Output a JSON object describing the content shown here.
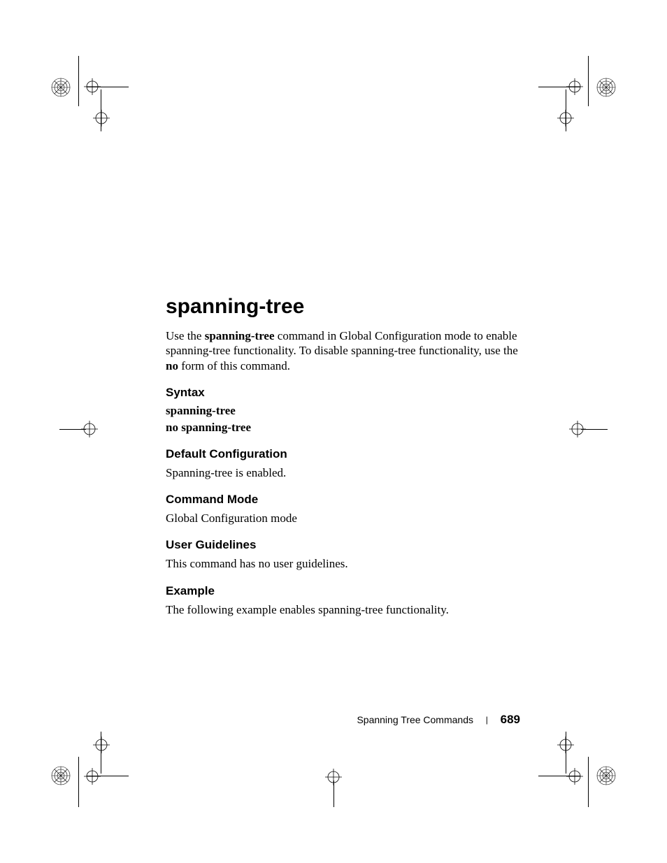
{
  "title": "spanning-tree",
  "intro": {
    "pre": "Use the ",
    "cmd": "spanning-tree",
    "mid": " command in Global Configuration mode to enable spanning-tree functionality. To disable spanning-tree functionality, use the ",
    "no": "no",
    "post": " form of this command."
  },
  "sections": {
    "syntax": {
      "heading": "Syntax",
      "lines": [
        "spanning-tree",
        "no spanning-tree"
      ]
    },
    "default_config": {
      "heading": "Default Configuration",
      "text": "Spanning-tree is enabled."
    },
    "command_mode": {
      "heading": "Command Mode",
      "text": "Global Configuration mode"
    },
    "user_guidelines": {
      "heading": "User Guidelines",
      "text": "This command has no user guidelines."
    },
    "example": {
      "heading": "Example",
      "text": "The following example enables spanning-tree functionality."
    }
  },
  "footer": {
    "section_name": "Spanning Tree Commands",
    "separator": "|",
    "page_number": "689"
  }
}
